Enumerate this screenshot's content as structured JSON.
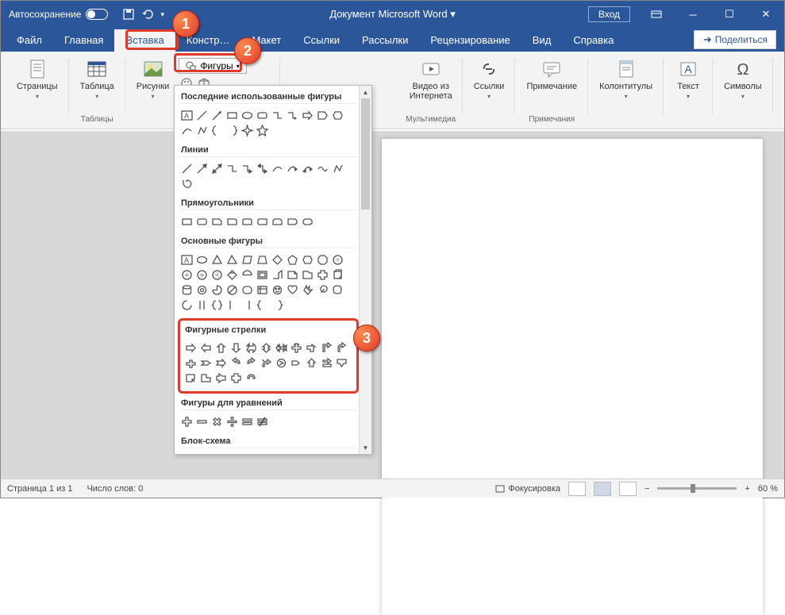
{
  "titlebar": {
    "autosave": "Автосохранение",
    "doc_title": "Документ Microsoft Word ▾",
    "login": "Вход"
  },
  "tabs": {
    "file": "Файл",
    "home": "Главная",
    "insert": "Вставка",
    "design": "Констр…",
    "layout": "Макет",
    "references": "Ссылки",
    "mailings": "Рассылки",
    "review": "Рецензирование",
    "view": "Вид",
    "help": "Справка",
    "share": "Поделиться"
  },
  "ribbon": {
    "pages": "Страницы",
    "table": "Таблица",
    "tables_group": "Таблицы",
    "pictures": "Рисунки",
    "shapes_btn": "Фигуры",
    "online_video": "Видео из Интернета",
    "media_group": "Мультимедиа",
    "links": "Ссылки",
    "comment": "Примечание",
    "comments_group": "Примечания",
    "header_footer": "Колонтитулы",
    "text": "Текст",
    "symbols": "Символы"
  },
  "shapes_panel": {
    "recent": "Последние использованные фигуры",
    "lines": "Линии",
    "rectangles": "Прямоугольники",
    "basic": "Основные фигуры",
    "block_arrows": "Фигурные стрелки",
    "equation": "Фигуры для уравнений",
    "flowchart": "Блок-схема"
  },
  "status": {
    "page": "Страница 1 из 1",
    "words": "Число слов: 0",
    "focus": "Фокусировка",
    "zoom": "60 %"
  },
  "callouts": {
    "c1": "1",
    "c2": "2",
    "c3": "3"
  }
}
